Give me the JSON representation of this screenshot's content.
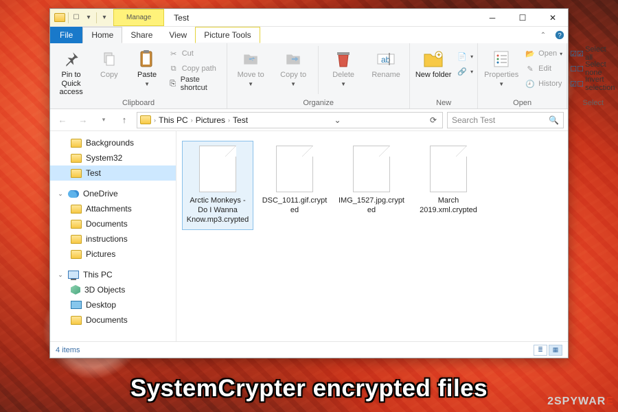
{
  "window": {
    "title": "Test",
    "context_label": "Manage"
  },
  "menubar": {
    "file": "File",
    "tabs": [
      "Home",
      "Share",
      "View"
    ],
    "context_tab": "Picture Tools"
  },
  "ribbon": {
    "clipboard": {
      "label": "Clipboard",
      "pin": "Pin to Quick access",
      "copy": "Copy",
      "paste": "Paste",
      "cut": "Cut",
      "copy_path": "Copy path",
      "paste_shortcut": "Paste shortcut"
    },
    "organize": {
      "label": "Organize",
      "move_to": "Move to",
      "copy_to": "Copy to",
      "delete": "Delete",
      "rename": "Rename"
    },
    "new": {
      "label": "New",
      "new_folder": "New folder"
    },
    "open": {
      "label": "Open",
      "properties": "Properties",
      "open": "Open",
      "edit": "Edit",
      "history": "History"
    },
    "select": {
      "label": "Select",
      "select_all": "Select all",
      "select_none": "Select none",
      "invert": "Invert selection"
    }
  },
  "breadcrumbs": [
    "This PC",
    "Pictures",
    "Test"
  ],
  "search": {
    "placeholder": "Search Test"
  },
  "sidebar": {
    "quick": [
      "Backgrounds",
      "System32",
      "Test"
    ],
    "onedrive": {
      "label": "OneDrive",
      "children": [
        "Attachments",
        "Documents",
        "instructions",
        "Pictures"
      ]
    },
    "thispc": {
      "label": "This PC",
      "children": [
        "3D Objects",
        "Desktop",
        "Documents"
      ]
    }
  },
  "files": [
    "Arctic Monkeys - Do I Wanna Know.mp3.crypted",
    "DSC_1011.gif.crypted",
    "IMG_1527.jpg.crypted",
    "March 2019.xml.crypted"
  ],
  "status": {
    "count": "4 items"
  },
  "caption": "SystemCrypter encrypted files",
  "watermark": {
    "a": "2SPYWAR",
    "b": "E"
  }
}
